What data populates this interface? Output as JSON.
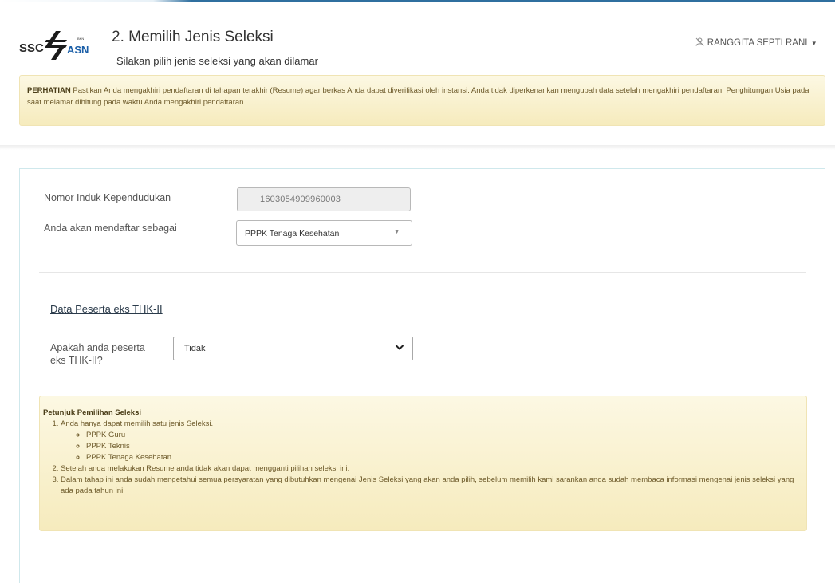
{
  "header": {
    "title": "2. Memilih Jenis Seleksi",
    "subtitle": "Silakan pilih jenis seleksi yang akan dilamar",
    "user_name": "RANGGITA SEPTI RANI",
    "logo_text": "SSCASN"
  },
  "notice": {
    "label": "PERHATIAN",
    "text": "Pastikan Anda mengakhiri pendaftaran di tahapan terakhir (Resume) agar berkas Anda dapat diverifikasi oleh instansi. Anda tidak diperkenankan mengubah data setelah mengakhiri pendaftaran. Penghitungan Usia pada saat melamar dihitung pada waktu Anda mengakhiri pendaftaran."
  },
  "form": {
    "nik_label": "Nomor Induk Kependudukan",
    "nik_value": "1603054909960003",
    "daftar_label": "Anda akan mendaftar sebagai",
    "daftar_value": "PPPK Tenaga Kesehatan"
  },
  "thk": {
    "section_title": "Data Peserta eks THK-II",
    "question_line1": "Apakah anda peserta",
    "question_line2": "eks THK-II?",
    "value": "Tidak"
  },
  "guide": {
    "title": "Petunjuk Pemilihan Seleksi",
    "item1": "Anda hanya dapat memilih satu jenis Seleksi.",
    "options": [
      "PPPK Guru",
      "PPPK Teknis",
      "PPPK Tenaga Kesehatan"
    ],
    "item2": "Setelah anda melakukan Resume anda tidak akan dapat mengganti pilihan seleksi ini.",
    "item3": "Dalam tahap ini anda sudah mengetahui semua persyaratan yang dibutuhkan mengenai Jenis Seleksi yang akan anda pilih, sebelum memilih kami sarankan anda sudah membaca informasi mengenai jenis seleksi yang ada pada tahun ini."
  }
}
